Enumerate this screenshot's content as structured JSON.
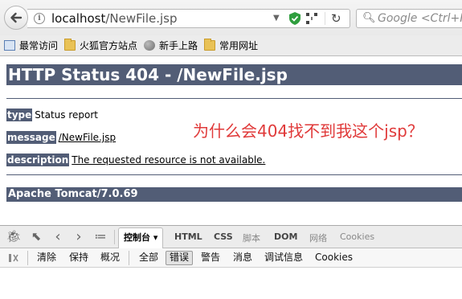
{
  "browser": {
    "url_host": "localhost",
    "url_path": "/NewFile.jsp",
    "search_placeholder": "Google <Ctrl+K>"
  },
  "bookmarks": [
    {
      "label": "最常访问",
      "icon": "bookmark-page-icon"
    },
    {
      "label": "火狐官方站点",
      "icon": "folder-icon"
    },
    {
      "label": "新手上路",
      "icon": "globe-icon"
    },
    {
      "label": "常用网址",
      "icon": "folder-icon"
    }
  ],
  "page": {
    "title": "HTTP Status 404 - /NewFile.jsp",
    "type_label": "type",
    "type_value": "Status report",
    "message_label": "message",
    "message_value": "/NewFile.jsp",
    "description_label": "description",
    "description_value": "The requested resource is not available.",
    "footer": "Apache Tomcat/7.0.69",
    "annotation": "为什么会404找不到我这个jsp？"
  },
  "devtools": {
    "tabs": {
      "console": "控制台 ▾",
      "html": "HTML",
      "css": "CSS",
      "script": "脚本",
      "dom": "DOM",
      "net": "网络",
      "cookies": "Cookies"
    },
    "filters": {
      "clear": "清除",
      "persist": "保持",
      "profile": "概况",
      "all": "全部",
      "errors": "错误",
      "warnings": "警告",
      "info": "消息",
      "debug": "调试信息",
      "cookies": "Cookies"
    }
  },
  "colors": {
    "tomcat_header": "#525d76",
    "annotation": "#e03a3a"
  }
}
